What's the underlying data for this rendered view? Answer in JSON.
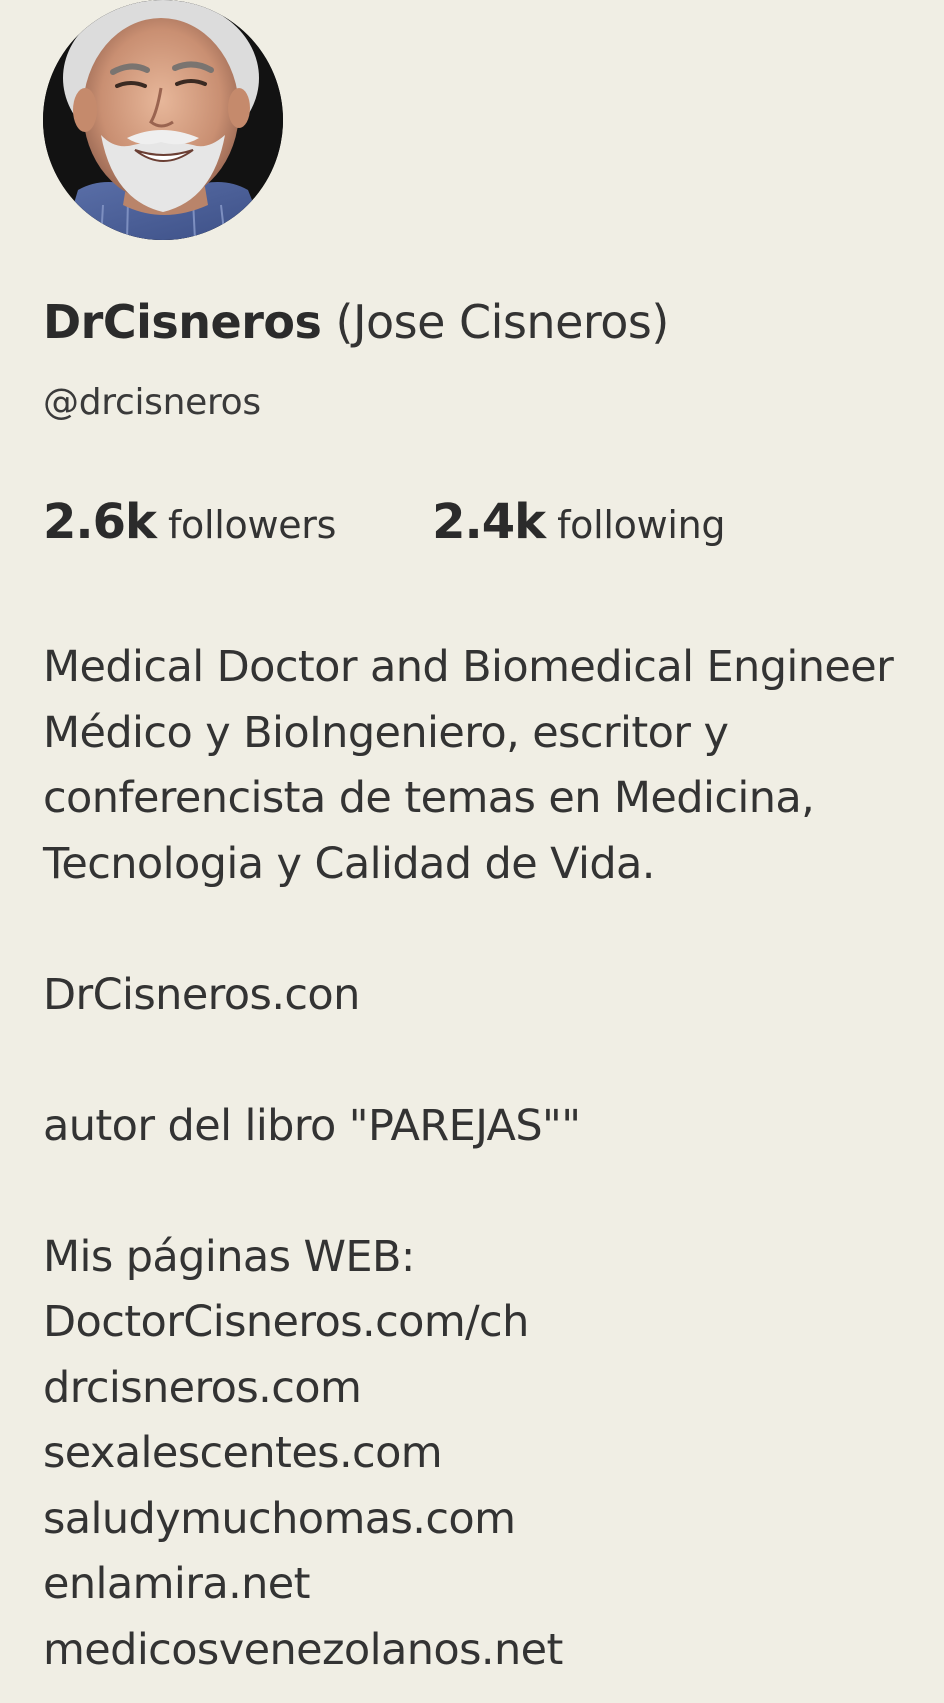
{
  "profile": {
    "display_name": "DrCisneros",
    "real_name": "(Jose Cisneros)",
    "handle": "@drcisneros",
    "avatar_alt": "profile-photo"
  },
  "stats": {
    "followers_count": "2.6k",
    "followers_label": "followers",
    "following_count": "2.4k",
    "following_label": "following"
  },
  "bio": {
    "line1": "Medical Doctor and Biomedical Engineer",
    "line2": "Médico y BioIngeniero, escritor y",
    "line3": "conferencista de temas en Medicina,",
    "line4": "Tecnologia y Calidad de Vida.",
    "line5": "DrCisneros.con",
    "line6": "autor del libro \"PAREJAS\"\"",
    "line7": "Mis páginas WEB:",
    "links": [
      "DoctorCisneros.com/ch",
      "drcisneros.com",
      "sexalescentes.com",
      "saludymuchomas.com",
      "enlamira.net",
      "medicosvenezolanos.net"
    ]
  },
  "colors": {
    "background": "#f0eee4",
    "text": "#2f2f2f"
  }
}
